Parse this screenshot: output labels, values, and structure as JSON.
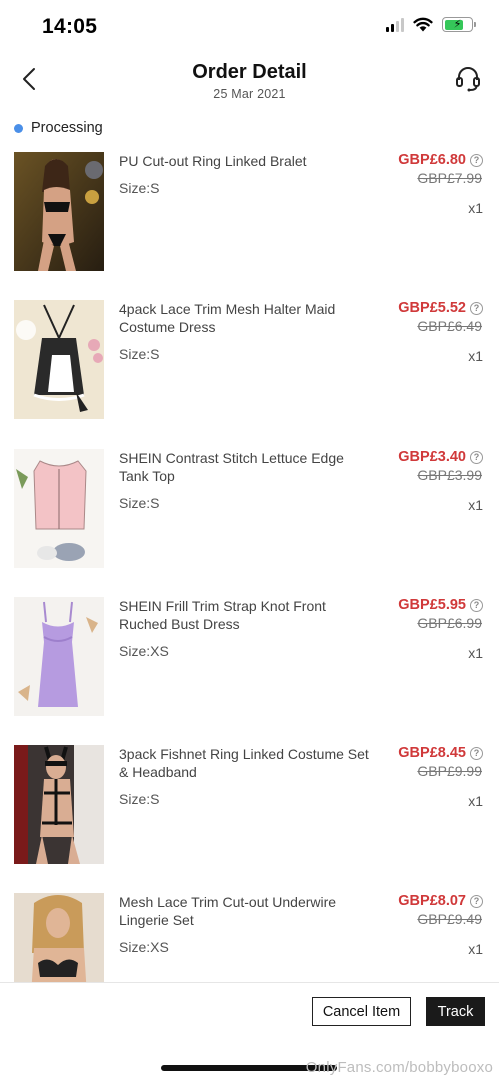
{
  "status_bar": {
    "time": "14:05",
    "icons": [
      "cellular-signal-icon",
      "wifi-icon",
      "battery-charging-icon"
    ]
  },
  "header": {
    "title": "Order Detail",
    "date": "25 Mar 2021",
    "back_icon": "chevron-left-icon",
    "support_icon": "headset-icon"
  },
  "order_status": {
    "label": "Processing",
    "dot_color": "#4a8fe8"
  },
  "items": [
    {
      "name": "PU Cut-out Ring Linked Bralet",
      "size": "Size:S",
      "price": "GBP£6.80",
      "original_price": "GBP£7.99",
      "qty": "x1"
    },
    {
      "name": "4pack Lace Trim Mesh Halter Maid Costume Dress",
      "size": "Size:S",
      "price": "GBP£5.52",
      "original_price": "GBP£6.49",
      "qty": "x1"
    },
    {
      "name": "SHEIN Contrast Stitch Lettuce Edge Tank Top",
      "size": "Size:S",
      "price": "GBP£3.40",
      "original_price": "GBP£3.99",
      "qty": "x1"
    },
    {
      "name": "SHEIN Frill Trim Strap Knot Front Ruched Bust Dress",
      "size": "Size:XS",
      "price": "GBP£5.95",
      "original_price": "GBP£6.99",
      "qty": "x1"
    },
    {
      "name": "3pack Fishnet Ring Linked Costume Set & Headband",
      "size": "Size:S",
      "price": "GBP£8.45",
      "original_price": "GBP£9.99",
      "qty": "x1"
    },
    {
      "name": "Mesh Lace Trim Cut-out Underwire Lingerie Set",
      "size": "Size:XS",
      "price": "GBP£8.07",
      "original_price": "GBP£9.49",
      "qty": "x1"
    }
  ],
  "actions": {
    "cancel_label": "Cancel Item",
    "track_label": "Track"
  },
  "watermark": "OnlyFans.com/bobbybooxo",
  "colors": {
    "price": "#d0393a",
    "accent_dark": "#1a1a1a",
    "battery": "#35c759"
  }
}
